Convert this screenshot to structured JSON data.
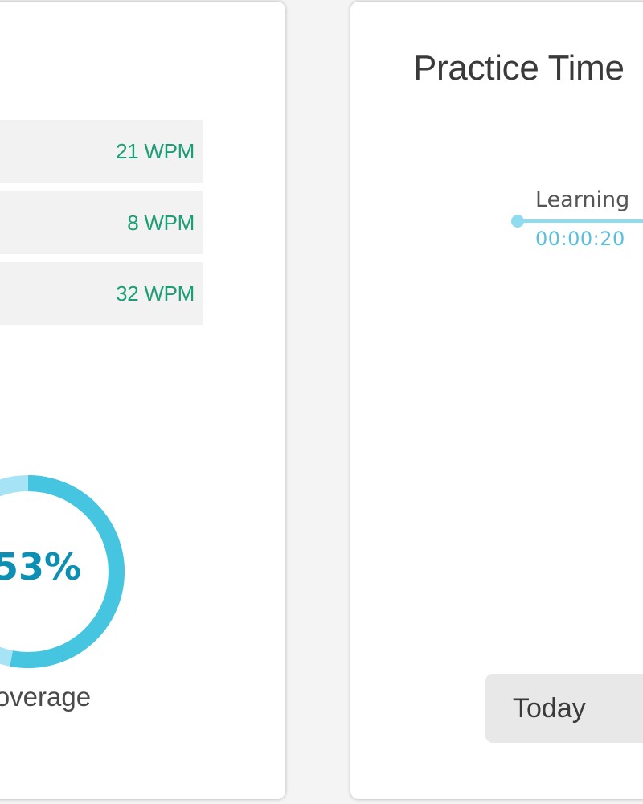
{
  "speed_card": {
    "rows": [
      {
        "value": "21 WPM"
      },
      {
        "value": "8 WPM"
      },
      {
        "value": "32 WPM"
      }
    ],
    "coverage": {
      "percent": 53,
      "value_text": "53%",
      "label": "Coverage",
      "colors": {
        "filled": "#45c5df",
        "remaining": "#a6e4f5",
        "text": "#0d8fb3"
      }
    }
  },
  "practice_card": {
    "title": "Practice Time",
    "timeline": {
      "label": "Learning",
      "time": "00:00:20"
    },
    "range_select": {
      "selected": "Today"
    }
  }
}
